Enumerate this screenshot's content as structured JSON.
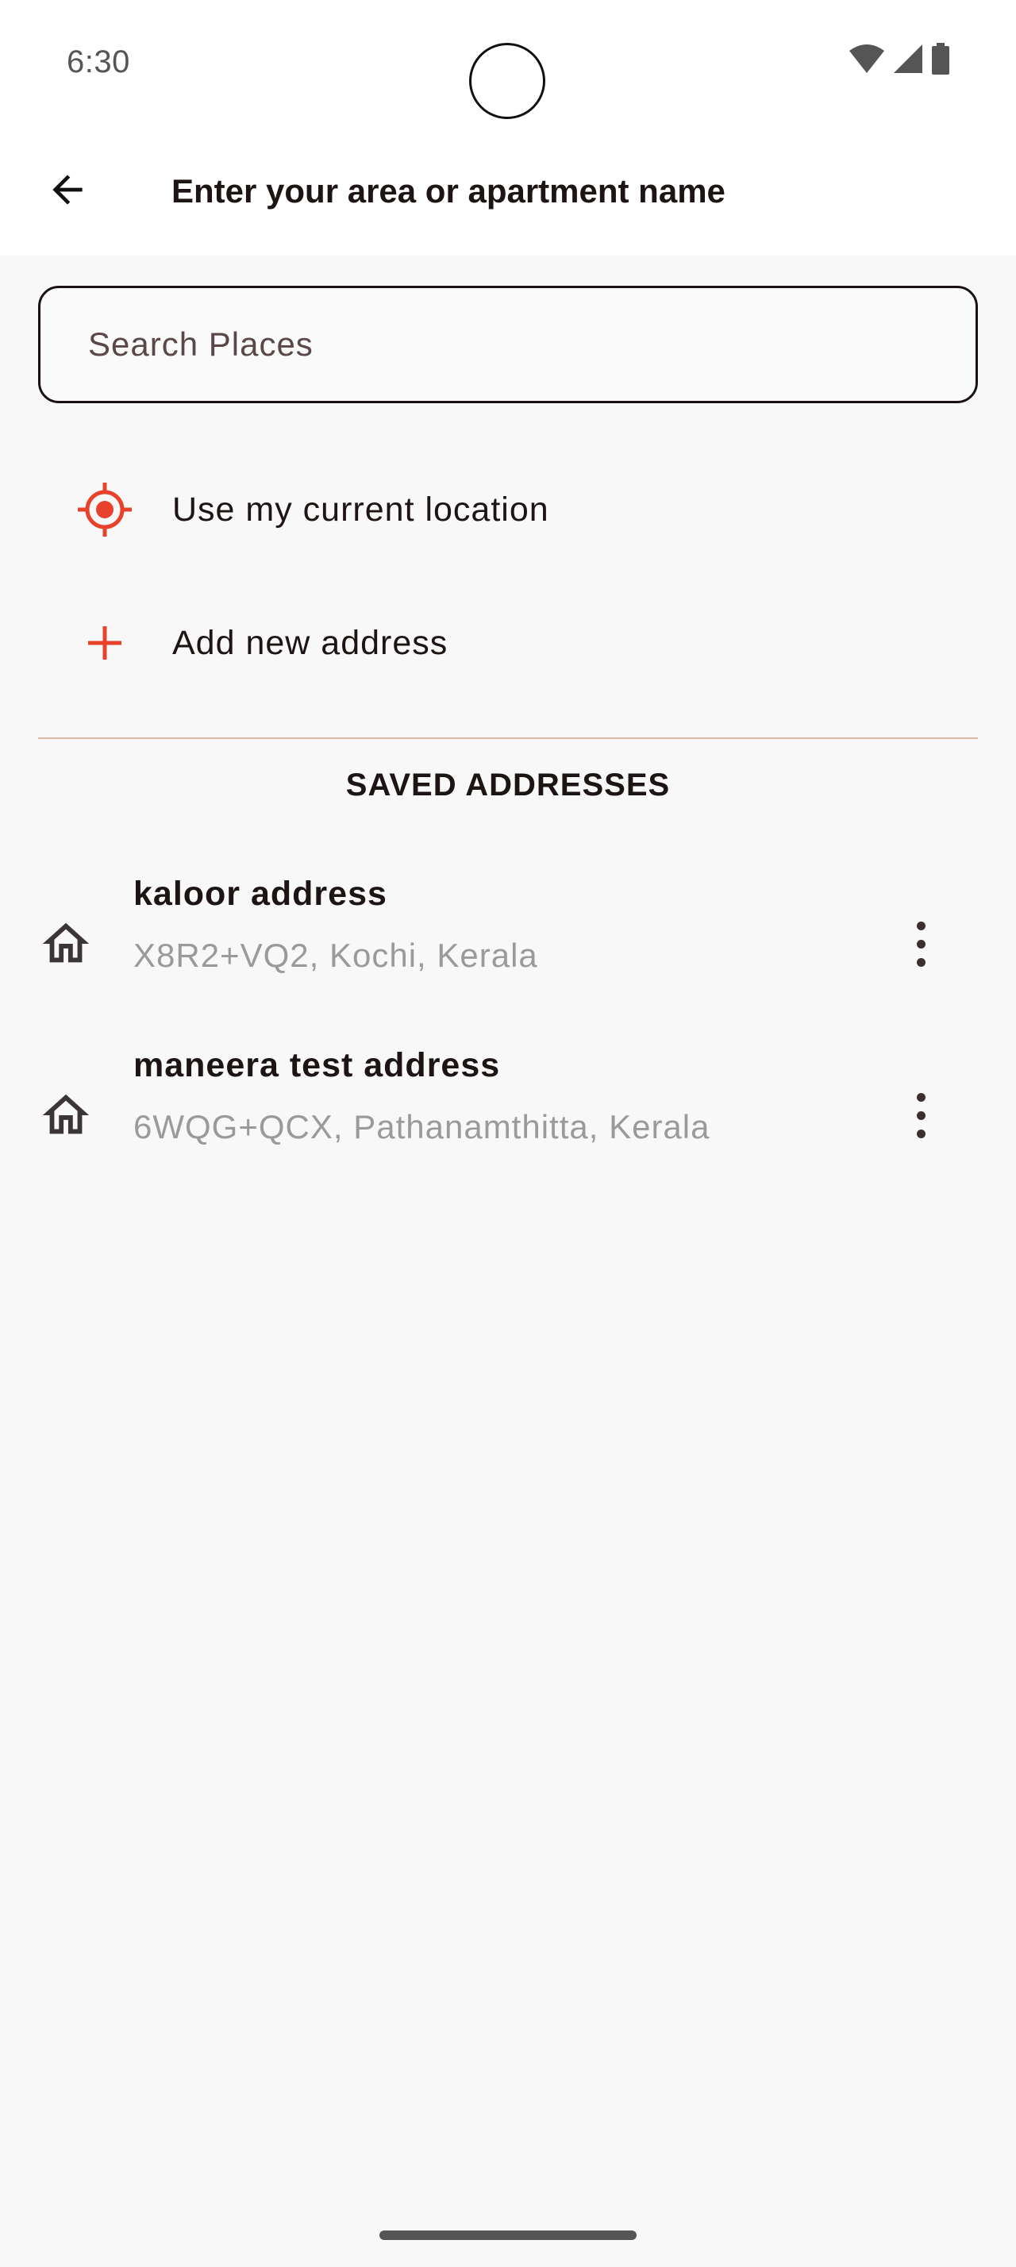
{
  "status_bar": {
    "time": "6:30",
    "icons": [
      "wifi-icon",
      "signal-icon",
      "battery-icon"
    ]
  },
  "app_bar": {
    "back_icon": "arrow-left-icon",
    "title": "Enter your area or apartment name"
  },
  "search": {
    "placeholder": "Search Places",
    "value": ""
  },
  "options": [
    {
      "icon": "gps-target-icon",
      "label": "Use my current location"
    },
    {
      "icon": "plus-icon",
      "label": "Add new address"
    }
  ],
  "saved_section": {
    "title": "SAVED ADDRESSES",
    "items": [
      {
        "icon": "home-icon",
        "name": "kaloor address",
        "detail": "X8R2+VQ2, Kochi, Kerala",
        "menu_icon": "more-vert-icon"
      },
      {
        "icon": "home-icon",
        "name": "maneera test address",
        "detail": "6WQG+QCX, Pathanamthitta, Kerala",
        "menu_icon": "more-vert-icon"
      }
    ]
  },
  "colors": {
    "accent": "#e8412c",
    "text_primary": "#1d1414",
    "text_secondary": "#9a9a9a",
    "background": "#f8f8f8",
    "divider": "#d9b8aa"
  }
}
